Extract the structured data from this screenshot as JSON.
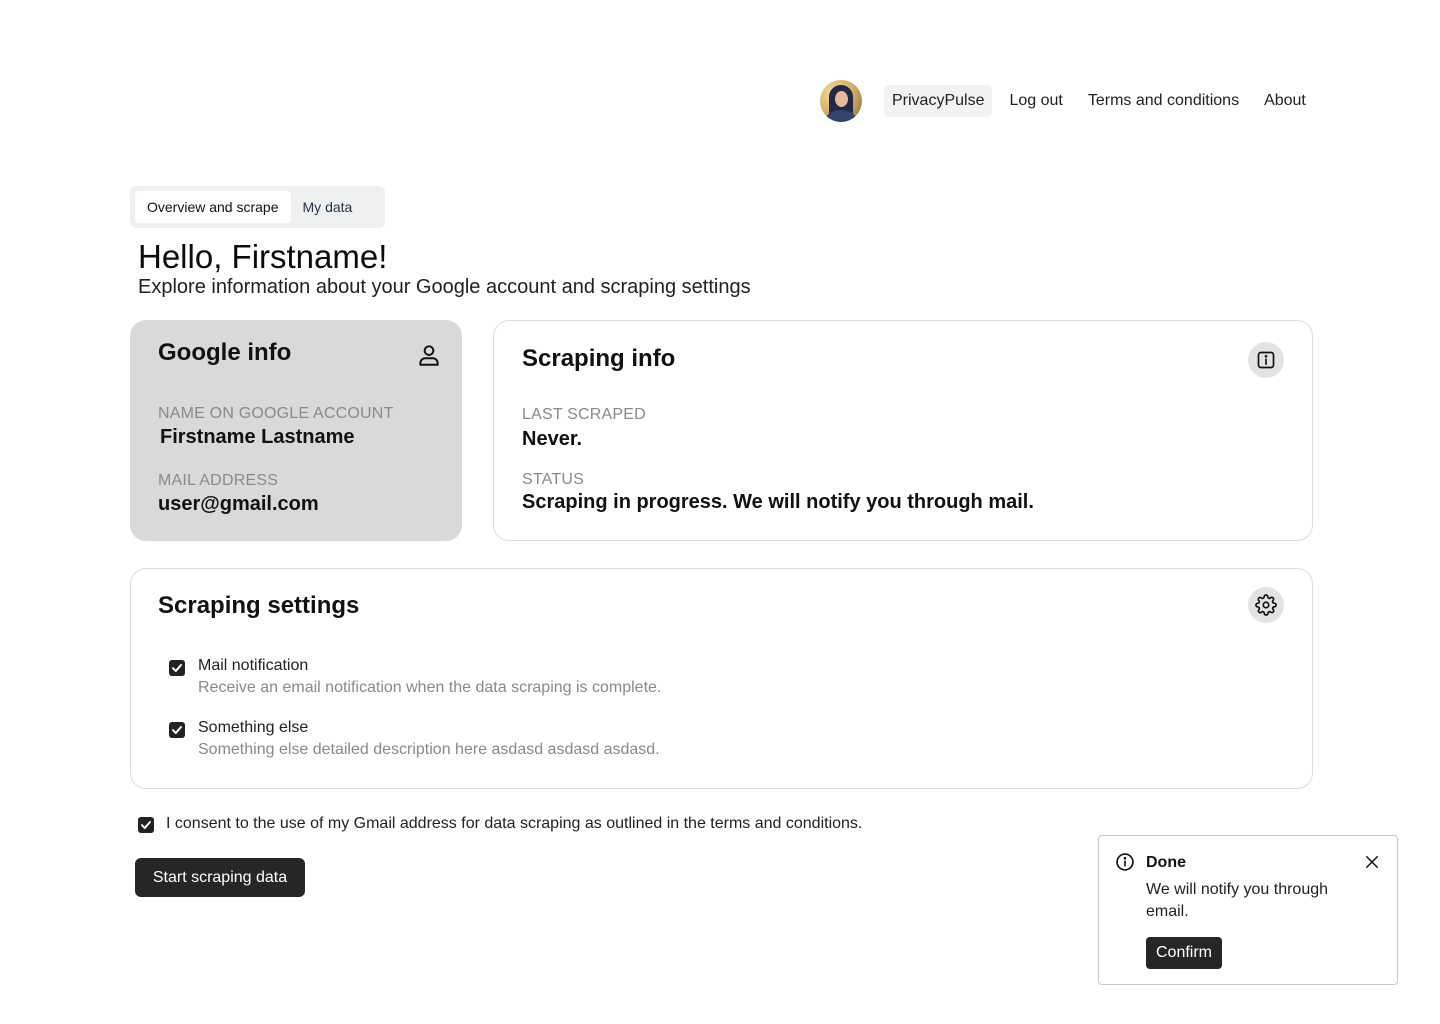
{
  "nav": {
    "avatar_alt": "User avatar",
    "links": [
      "PrivacyPulse",
      "Log out",
      "Terms and conditions",
      "About"
    ]
  },
  "tabs": [
    {
      "label": "Overview and scrape",
      "active": true
    },
    {
      "label": "My data",
      "active": false
    }
  ],
  "header": {
    "greeting": "Hello, Firstname!",
    "subtitle": "Explore information about your Google account and scraping settings"
  },
  "google_info": {
    "title": "Google info",
    "icon": "person-icon",
    "name_label": "NAME ON GOOGLE ACCOUNT",
    "name_value": "Firstname Lastname",
    "mail_label": "MAIL ADDRESS",
    "mail_value": "user@gmail.com"
  },
  "scraping_info": {
    "title": "Scraping info",
    "icon": "info-icon",
    "last_label": "LAST SCRAPED",
    "last_value": "Never.",
    "status_label": "STATUS",
    "status_value": "Scraping in progress. We will notify you through mail."
  },
  "settings": {
    "title": "Scraping settings",
    "icon": "gear-icon",
    "options": [
      {
        "title": "Mail notification",
        "desc": "Receive an email notification when the data scraping is complete.",
        "checked": true
      },
      {
        "title": "Something else",
        "desc": "Something else detailed description here asdasd asdasd asdasd.",
        "checked": true
      }
    ]
  },
  "consent": {
    "text": "I consent to the use of my Gmail address for data scraping as outlined in the terms and conditions.",
    "checked": true
  },
  "start_button": "Start scraping data",
  "toast": {
    "title": "Done",
    "message": "We will notify you through email.",
    "confirm": "Confirm"
  },
  "colors": {
    "dark_button": "#262626",
    "card_gray": "#d9d9d9",
    "muted_text": "#8a8a8a"
  }
}
